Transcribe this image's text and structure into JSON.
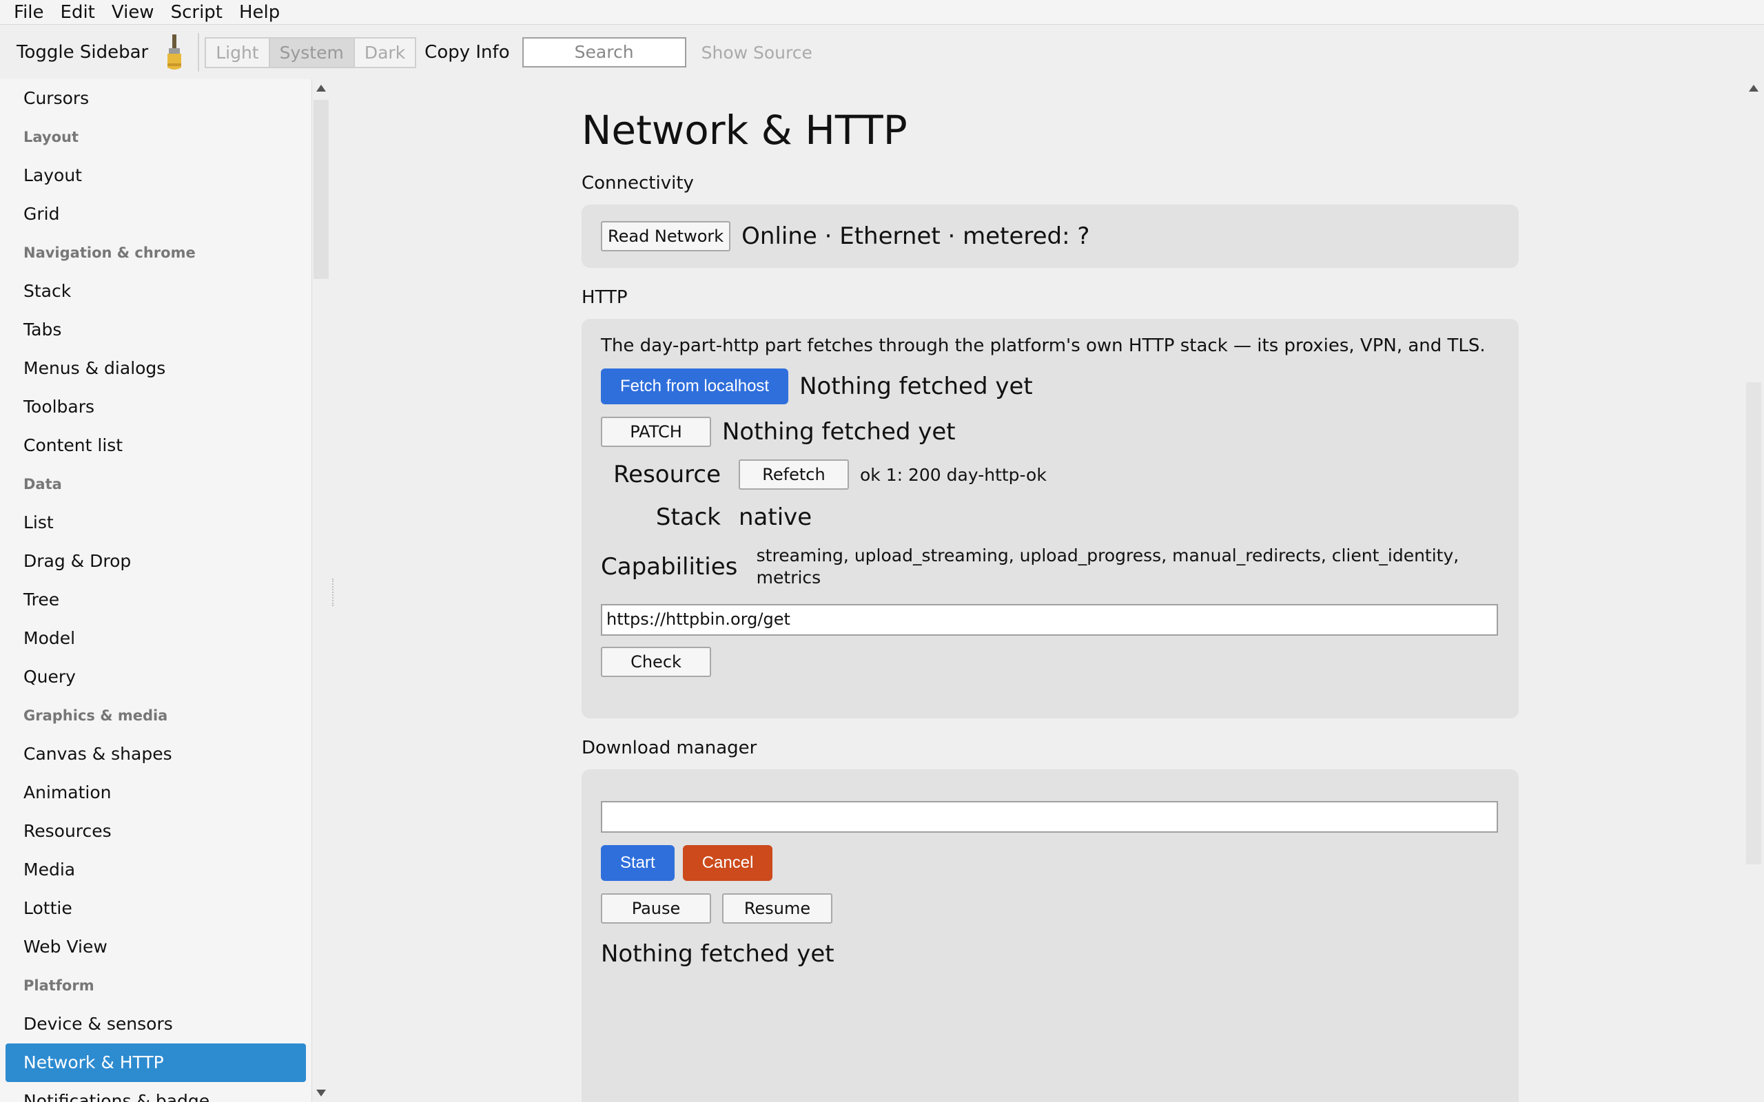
{
  "menubar": {
    "items": [
      "File",
      "Edit",
      "View",
      "Script",
      "Help"
    ]
  },
  "toolbar": {
    "toggle_sidebar": "Toggle Sidebar",
    "brush_icon": "paintbrush-icon",
    "theme": [
      "Light",
      "System",
      "Dark"
    ],
    "theme_selected": "System",
    "copy_info": "Copy Info",
    "search_placeholder": "Search",
    "show_source": "Show Source"
  },
  "sidebar": {
    "entries": [
      {
        "type": "item",
        "label": "Cursors"
      },
      {
        "type": "header",
        "label": "Layout"
      },
      {
        "type": "item",
        "label": "Layout"
      },
      {
        "type": "item",
        "label": "Grid"
      },
      {
        "type": "header",
        "label": "Navigation & chrome"
      },
      {
        "type": "item",
        "label": "Stack"
      },
      {
        "type": "item",
        "label": "Tabs"
      },
      {
        "type": "item",
        "label": "Menus & dialogs"
      },
      {
        "type": "item",
        "label": "Toolbars"
      },
      {
        "type": "item",
        "label": "Content list"
      },
      {
        "type": "header",
        "label": "Data"
      },
      {
        "type": "item",
        "label": "List"
      },
      {
        "type": "item",
        "label": "Drag & Drop"
      },
      {
        "type": "item",
        "label": "Tree"
      },
      {
        "type": "item",
        "label": "Model"
      },
      {
        "type": "item",
        "label": "Query"
      },
      {
        "type": "header",
        "label": "Graphics & media"
      },
      {
        "type": "item",
        "label": "Canvas & shapes"
      },
      {
        "type": "item",
        "label": "Animation"
      },
      {
        "type": "item",
        "label": "Resources"
      },
      {
        "type": "item",
        "label": "Media"
      },
      {
        "type": "item",
        "label": "Lottie"
      },
      {
        "type": "item",
        "label": "Web View"
      },
      {
        "type": "header",
        "label": "Platform"
      },
      {
        "type": "item",
        "label": "Device & sensors"
      },
      {
        "type": "item",
        "label": "Network & HTTP",
        "selected": true
      },
      {
        "type": "item",
        "label": "Notifications & badge"
      }
    ]
  },
  "main": {
    "title": "Network & HTTP",
    "connectivity": {
      "section": "Connectivity",
      "button": "Read Network",
      "status": "Online · Ethernet · metered: ?"
    },
    "http": {
      "section": "HTTP",
      "description": "The day-part-http part fetches through the platform's own HTTP stack — its proxies, VPN, and TLS.",
      "fetch_button": "Fetch from localhost",
      "fetch_status": "Nothing fetched yet",
      "patch_button": "PATCH",
      "patch_status": "Nothing fetched yet",
      "resource_label": "Resource",
      "refetch_button": "Refetch",
      "resource_value": "ok 1: 200 day-http-ok",
      "stack_label": "Stack",
      "stack_value": "native",
      "capabilities_label": "Capabilities",
      "capabilities_value": "streaming, upload_streaming, upload_progress, manual_redirects, client_identity, metrics",
      "url_value": "https://httpbin.org/get",
      "check_button": "Check"
    },
    "download": {
      "section": "Download manager",
      "url_value": "",
      "start_button": "Start",
      "cancel_button": "Cancel",
      "pause_button": "Pause",
      "resume_button": "Resume",
      "status": "Nothing fetched yet"
    }
  },
  "colors": {
    "accent_blue": "#2f6fdc",
    "selection_blue": "#2d8bd0",
    "cancel_red": "#cc4a1c"
  }
}
